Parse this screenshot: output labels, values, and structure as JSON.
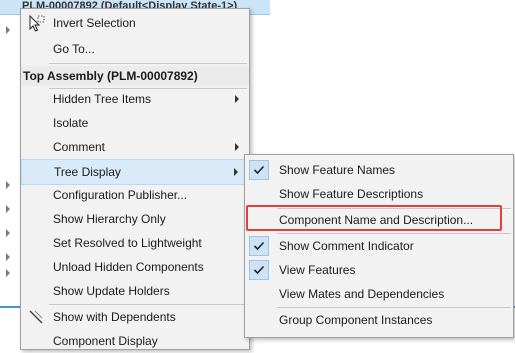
{
  "background": {
    "top_item_text": "PLM-00007892 (Default<Display State-1>)",
    "tree_arrow_rows": 8
  },
  "menu": {
    "items": [
      {
        "label": "Invert Selection",
        "icon": "cursor-select-icon",
        "has_submenu": false
      },
      {
        "label": "Go To...",
        "has_submenu": false
      }
    ],
    "header": "Top Assembly (PLM-00007892)",
    "items2": [
      {
        "label": "Hidden Tree Items",
        "has_submenu": true
      },
      {
        "label": "Isolate",
        "has_submenu": false
      },
      {
        "label": "Comment",
        "has_submenu": true
      },
      {
        "label": "Tree Display",
        "has_submenu": true,
        "highlighted": true
      },
      {
        "label": "Configuration Publisher...",
        "has_submenu": false
      },
      {
        "label": "Show Hierarchy Only",
        "has_submenu": false
      },
      {
        "label": "Set Resolved to Lightweight",
        "has_submenu": false
      },
      {
        "label": "Unload Hidden Components",
        "has_submenu": false
      },
      {
        "label": "Show Update Holders",
        "has_submenu": false
      }
    ],
    "items3": [
      {
        "label": "Show with Dependents",
        "icon": "dependents-icon"
      },
      {
        "label": "Component Display"
      }
    ]
  },
  "submenu": {
    "items": [
      {
        "label": "Show Feature Names",
        "checked": true
      },
      {
        "label": "Show Feature Descriptions",
        "checked": false
      },
      {
        "label": "Component Name and Description...",
        "checked": false,
        "emphasized": true
      },
      {
        "label": "Show Comment Indicator",
        "checked": true
      },
      {
        "label": "View Features",
        "checked": true
      },
      {
        "label": "View Mates and Dependencies",
        "checked": false
      },
      {
        "label": "Group Component Instances",
        "checked": false
      }
    ]
  },
  "colors": {
    "highlight": "#d9ebf9",
    "check_bg": "#cde3f5",
    "emphasis_box": "#e0403c"
  }
}
